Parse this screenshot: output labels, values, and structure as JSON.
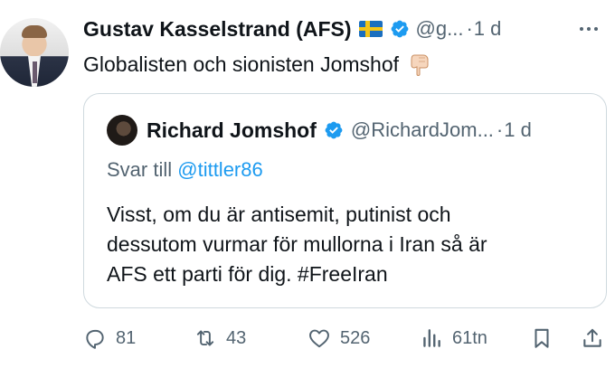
{
  "post": {
    "author": {
      "display_name": "Gustav Kasselstrand (AFS)",
      "handle": "@g...",
      "separator": "·",
      "time": "1 d",
      "flag_icon": "swedish-flag-icon",
      "verified_icon": "verified-badge-icon"
    },
    "text": "Globalisten och sionisten Jomshof",
    "emoji_icon": "backhand-index-pointing-down-icon"
  },
  "quote": {
    "author": {
      "display_name": "Richard Jomshof",
      "handle": "@RichardJom...",
      "separator": "·",
      "time": "1 d"
    },
    "reply_prefix": "Svar till",
    "reply_mention": "@tittler86",
    "body_lines": [
      "Visst, om du är antisemit, putinist och",
      "dessutom vurmar för mullorna i Iran så är",
      "AFS ett parti för dig. #FreeIran"
    ]
  },
  "actions": {
    "replies": "81",
    "reposts": "43",
    "likes": "526",
    "views": "61tn"
  },
  "colors": {
    "text": "#0f1419",
    "muted": "#536471",
    "link": "#1d9bf0",
    "verified": "#1d9bf0",
    "border": "#cfd9de"
  }
}
